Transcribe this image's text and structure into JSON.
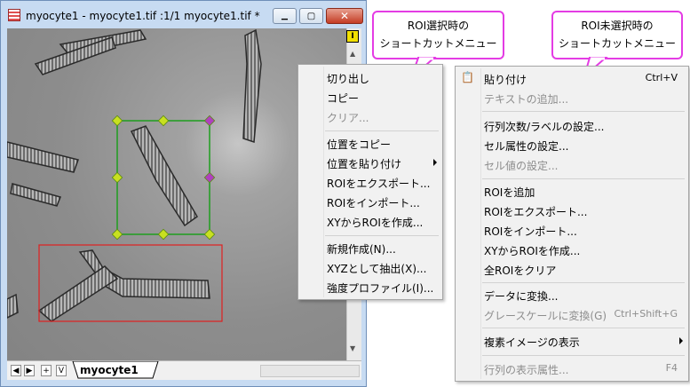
{
  "window": {
    "title": "myocyte1 - myocyte1.tif :1/1 myocyte1.tif *",
    "minimize_glyph": "▁",
    "maximize_glyph": "▢",
    "close_glyph": "✕"
  },
  "canvas": {
    "roi_badge": "I"
  },
  "sheet_bar": {
    "nav_first": "◀",
    "nav_next": "▶",
    "nav_add": "+",
    "nav_v": "V",
    "sheet_tab": "myocyte1"
  },
  "callouts": {
    "roi_selected": "ROI選択時の\nショートカットメニュー",
    "roi_unselected": "ROI未選択時の\nショートカットメニュー"
  },
  "menu_roi_selected": {
    "items": [
      {
        "label": "切り出し",
        "disabled": false
      },
      {
        "label": "コピー",
        "disabled": false
      },
      {
        "label": "クリア...",
        "disabled": true
      },
      {
        "label": "位置をコピー",
        "disabled": false
      },
      {
        "label": "位置を貼り付け",
        "disabled": false,
        "submenu": true
      },
      {
        "label": "ROIをエクスポート...",
        "disabled": false
      },
      {
        "label": "ROIをインポート...",
        "disabled": false
      },
      {
        "label": "XYからROIを作成...",
        "disabled": false
      },
      {
        "label": "新規作成(N)...",
        "disabled": false
      },
      {
        "label": "XYZとして抽出(X)...",
        "disabled": false
      },
      {
        "label": "強度プロファイル(I)...",
        "disabled": false
      }
    ]
  },
  "menu_roi_unselected": {
    "items": [
      {
        "label": "貼り付け",
        "shortcut": "Ctrl+V",
        "disabled": false,
        "icon": "paste-icon"
      },
      {
        "label": "テキストの追加...",
        "disabled": true
      },
      {
        "label": "行列次数/ラベルの設定...",
        "disabled": false
      },
      {
        "label": "セル属性の設定...",
        "disabled": false
      },
      {
        "label": "セル値の設定...",
        "disabled": true
      },
      {
        "label": "ROIを追加",
        "disabled": false
      },
      {
        "label": "ROIをエクスポート...",
        "disabled": false
      },
      {
        "label": "ROIをインポート...",
        "disabled": false
      },
      {
        "label": "XYからROIを作成...",
        "disabled": false
      },
      {
        "label": "全ROIをクリア",
        "disabled": false
      },
      {
        "label": "データに変換...",
        "disabled": false
      },
      {
        "label": "グレースケールに変換(G)",
        "shortcut": "Ctrl+Shift+G",
        "disabled": true
      },
      {
        "label": "複素イメージの表示",
        "disabled": false,
        "submenu": true
      },
      {
        "label": "行列の表示属性...",
        "shortcut": "F4",
        "disabled": true
      }
    ]
  },
  "colors": {
    "roi_rect_green": "#1e9e1e",
    "roi_handle": "#c8e020",
    "roi_rect_red": "#e02020",
    "callout_border": "#e43ce4",
    "disabled_text": "#8d8d8d"
  }
}
